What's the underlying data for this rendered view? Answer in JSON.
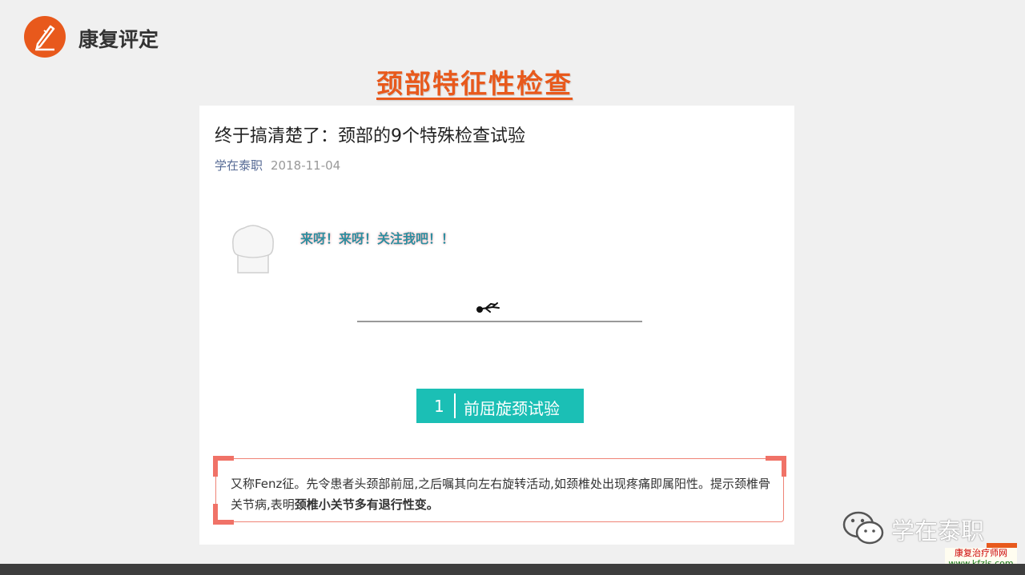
{
  "header": {
    "app_title": "康复评定",
    "slide_title": "颈部特征性检查"
  },
  "article": {
    "title": "终于搞清楚了：颈部的9个特殊检查试验",
    "author": "学在泰职",
    "date": "2018-11-04",
    "follow_text": "来呀！来呀！关注我吧！！",
    "step": {
      "number": "1",
      "name": "前屈旋颈试验"
    },
    "description": {
      "part1": "又称Fenz征。先令患者头颈部前屈,之后嘱其向左右旋转活动,如颈椎处出现疼痛即属阳性。提示颈椎骨关节病,表明",
      "bold": "颈椎小关节多有退行性变。"
    }
  },
  "watermark": {
    "wechat_account": "学在泰职",
    "site_name": "康复治疗师网",
    "site_url": "www.kfzls.com"
  },
  "colors": {
    "accent": "#e8591c",
    "teal": "#1bbfb5",
    "frame": "#ef8376",
    "link": "#576b95"
  }
}
